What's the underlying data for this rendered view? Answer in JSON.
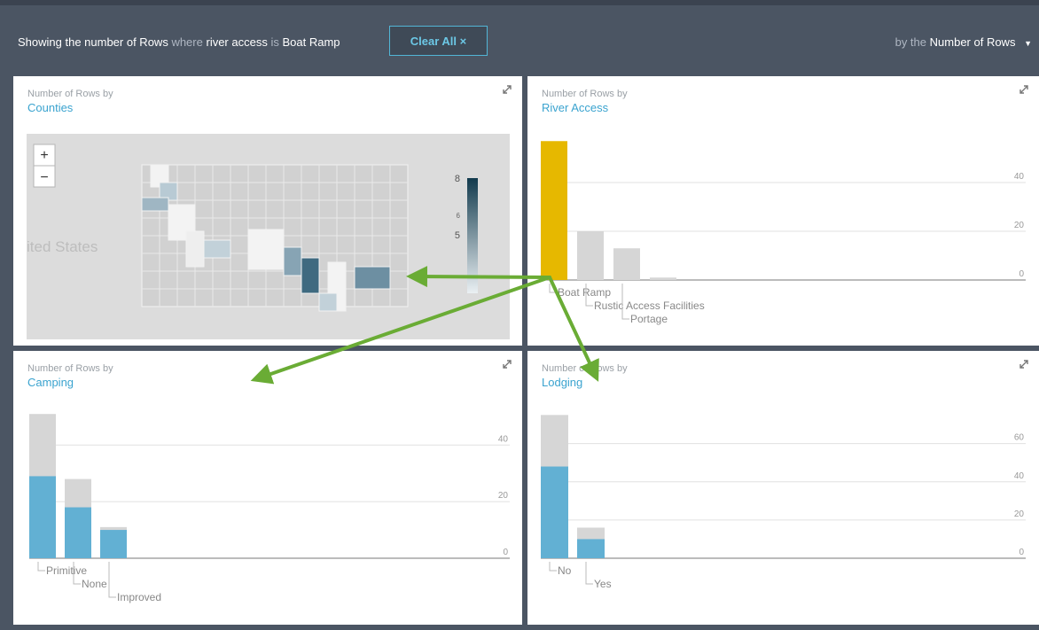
{
  "filter": {
    "prefix": "Showing the number of Rows",
    "where": "where",
    "field": "river access",
    "is": "is",
    "value": "Boat Ramp"
  },
  "clear_button": "Clear All ×",
  "measure": {
    "by_the": "by the",
    "label": "Number of Rows"
  },
  "panels": [
    {
      "subtitle": "Number of Rows by",
      "title": "Counties"
    },
    {
      "subtitle": "Number of Rows by",
      "title": "River Access"
    },
    {
      "subtitle": "Number of Rows by",
      "title": "Camping"
    },
    {
      "subtitle": "Number of Rows by",
      "title": "Lodging"
    }
  ],
  "map": {
    "zoom_in": "+",
    "zoom_out": "−",
    "country_label": "ited States",
    "legend_max": "8",
    "legend_mid_minor": "6",
    "legend_mid": "5"
  },
  "colors": {
    "highlight": "#e6b800",
    "bar_blue": "#62b0d3",
    "bar_gray": "#d6d6d6",
    "arrow_green": "#6aac35"
  },
  "chart_data": [
    {
      "type": "bar",
      "title": "River Access",
      "categories": [
        "Boat Ramp",
        "Rustic Access Facilities",
        "Portage",
        ""
      ],
      "series": [
        {
          "values": [
            57,
            20,
            13,
            1
          ]
        }
      ],
      "ylim": [
        0,
        60
      ],
      "yticks": [
        "0",
        "20",
        "40"
      ],
      "highlight": "Boat Ramp"
    },
    {
      "type": "bar",
      "title": "Camping",
      "categories": [
        "Primitive",
        "None",
        "Improved"
      ],
      "series": [
        {
          "values": [
            51,
            28,
            11
          ]
        },
        {
          "values": [
            29,
            18,
            10
          ]
        }
      ],
      "ylim": [
        0,
        52
      ],
      "yticks": [
        "0",
        "20",
        "40"
      ]
    },
    {
      "type": "bar",
      "title": "Lodging",
      "categories": [
        "No",
        "Yes"
      ],
      "series": [
        {
          "values": [
            75,
            16
          ]
        },
        {
          "values": [
            48,
            10
          ]
        }
      ],
      "ylim": [
        0,
        77
      ],
      "yticks": [
        "0",
        "20",
        "40",
        "60"
      ]
    }
  ]
}
